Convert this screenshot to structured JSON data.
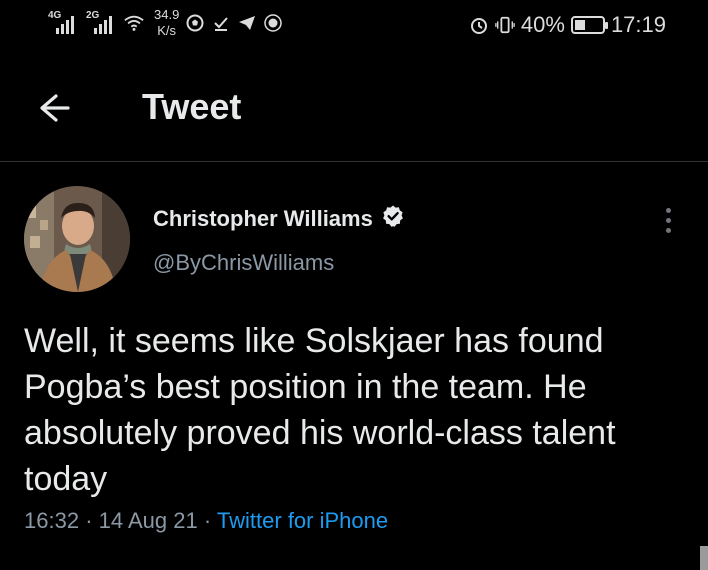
{
  "status_bar": {
    "sim1": "4G",
    "sim2": "2G",
    "speed_value": "34.9",
    "speed_unit": "K/s",
    "battery_percent": "40%",
    "battery_level": 0.4,
    "time": "17:19",
    "icons": [
      "wifi-icon",
      "football-icon",
      "download-icon",
      "telegram-icon",
      "club-crest-icon",
      "alarm-icon",
      "vibrate-icon",
      "battery-icon"
    ]
  },
  "header": {
    "title": "Tweet",
    "back_icon": "arrow-left-icon"
  },
  "tweet": {
    "author_name": "Christopher Williams",
    "verified": true,
    "handle": "@ByChrisWilliams",
    "text": "Well, it seems like Solskjaer has found Pogba’s best position in the team. He absolutely proved his world-class talent today",
    "time": "16:32",
    "date": "14 Aug 21",
    "source": "Twitter for iPhone",
    "separator": "·"
  },
  "colors": {
    "background": "#000000",
    "text_primary": "#e7e9ea",
    "text_secondary": "#8b98a5",
    "link": "#1d9bf0",
    "divider": "#2f3336"
  }
}
